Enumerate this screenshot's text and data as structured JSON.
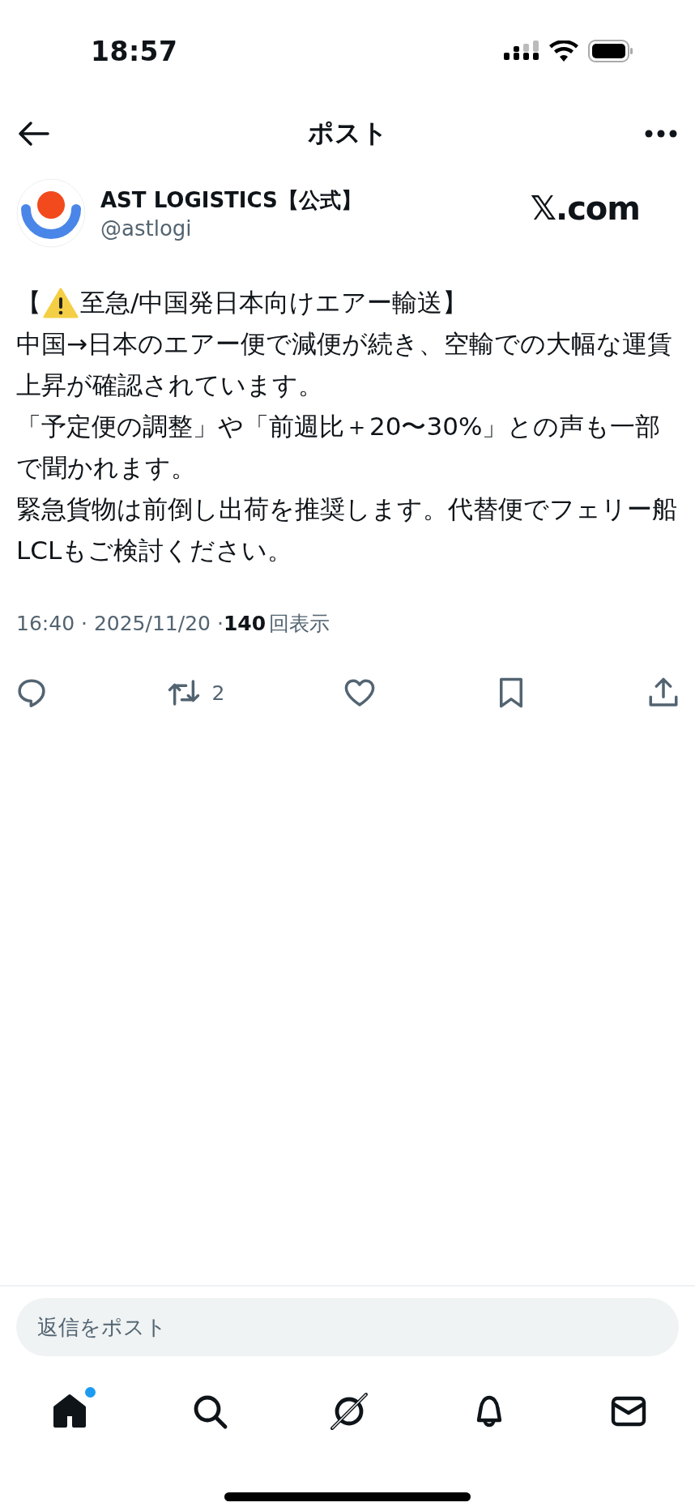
{
  "status_bar": {
    "time": "18:57"
  },
  "header": {
    "title": "ポスト"
  },
  "post": {
    "author": {
      "name": "AST LOGISTICS【公式】",
      "handle": "@astlogi"
    },
    "brand_mark": "𝕏.com",
    "headline": {
      "open": "【",
      "text": "至急/中国発日本向けエアー輸送】"
    },
    "paragraphs": [
      "中国→日本のエアー便で減便が続き、空輸での大幅な運賃上昇が確認されています。",
      "「予定便の調整」や「前週比＋20〜30%」との声も一部で聞かれます。",
      "緊急貨物は前倒し出荷を推奨します。代替便でフェリー船LCLもご検討ください。"
    ],
    "meta": {
      "time": "16:40 · 2025/11/20 · ",
      "views": "140",
      "views_label": "回表示"
    },
    "actions": [
      {
        "kind": "reply"
      },
      {
        "kind": "repost",
        "count": "2"
      },
      {
        "kind": "like"
      },
      {
        "kind": "bookmark"
      },
      {
        "kind": "share"
      }
    ]
  },
  "reply_field": {
    "placeholder": "返信をポスト"
  },
  "nav": [
    {
      "kind": "home",
      "selected": true,
      "dot": true
    },
    {
      "kind": "search",
      "selected": false,
      "dot": false
    },
    {
      "kind": "grok",
      "selected": false,
      "dot": false
    },
    {
      "kind": "notifications",
      "selected": false,
      "dot": false
    },
    {
      "kind": "messages",
      "selected": false,
      "dot": false
    }
  ]
}
